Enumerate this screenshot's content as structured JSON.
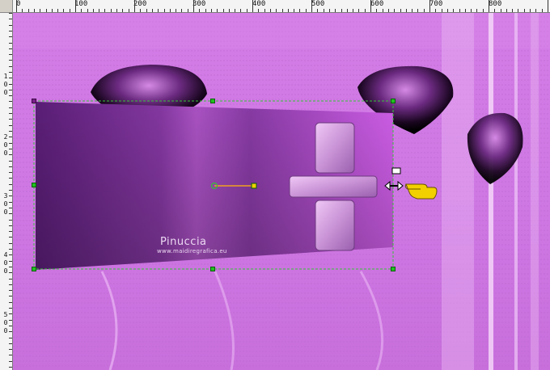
{
  "rulers": {
    "top_labels": [
      "0",
      "100",
      "200",
      "300",
      "400",
      "500",
      "600",
      "700",
      "800"
    ],
    "left_labels": [
      [
        "1",
        "0",
        "0"
      ],
      [
        "2",
        "0",
        "0"
      ],
      [
        "3",
        "0",
        "0"
      ],
      [
        "4",
        "0",
        "0"
      ],
      [
        "5",
        "0",
        "0"
      ]
    ]
  },
  "watermark": {
    "name": "Pinuccia",
    "site": "www.maidiregrafica.eu"
  },
  "colors": {
    "canvas": "#d07be6",
    "panel_dark": "#6a2a86",
    "panel_light": "#d860f2",
    "selection": "#35c435",
    "cursor_hand": "#f2d000"
  },
  "tool": {
    "cursor": "pointing-hand-icon",
    "resize": "horizontal-resize-arrow-icon"
  }
}
